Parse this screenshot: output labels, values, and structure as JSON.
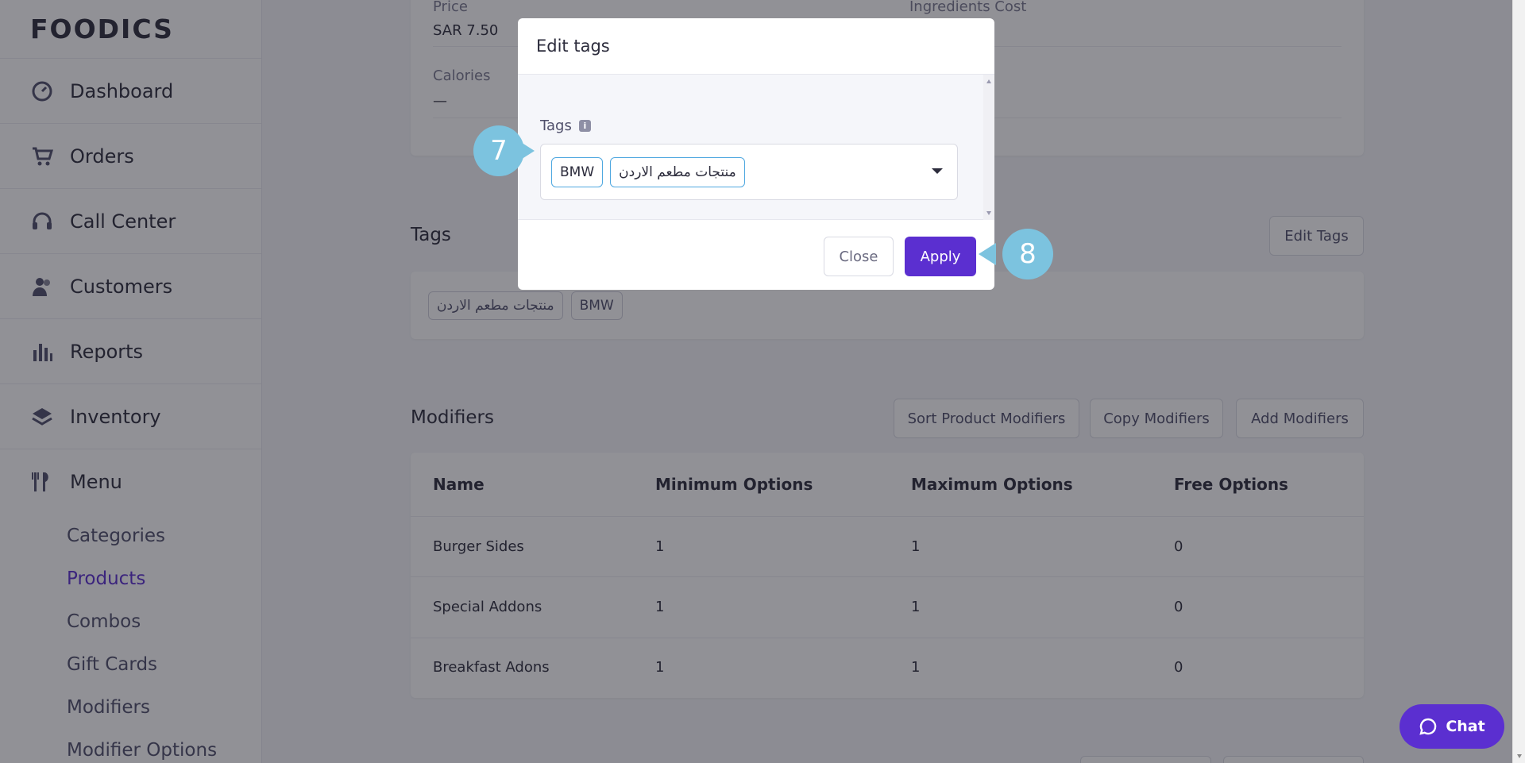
{
  "brand": {
    "logo_text": "FOODICS"
  },
  "sidebar": {
    "items": [
      {
        "label": "Dashboard",
        "icon": "dashboard-icon"
      },
      {
        "label": "Orders",
        "icon": "cart-icon"
      },
      {
        "label": "Call Center",
        "icon": "headset-icon"
      },
      {
        "label": "Customers",
        "icon": "users-icon"
      },
      {
        "label": "Reports",
        "icon": "bar-chart-icon"
      },
      {
        "label": "Inventory",
        "icon": "layers-icon"
      },
      {
        "label": "Menu",
        "icon": "utensils-icon"
      }
    ],
    "menu_subitems": [
      "Categories",
      "Products",
      "Combos",
      "Gift Cards",
      "Modifiers",
      "Modifier Options"
    ],
    "active_subitem": "Products"
  },
  "product_info": {
    "price_label": "Price",
    "price_value": "SAR 7.50",
    "ingredients_cost_label": "Ingredients Cost",
    "calories_label": "Calories",
    "calories_value": "—"
  },
  "tags_section": {
    "title": "Tags",
    "edit_button": "Edit Tags",
    "tags": [
      "منتجات مطعم الاردن",
      "BMW"
    ]
  },
  "modifiers_section": {
    "title": "Modifiers",
    "buttons": {
      "sort": "Sort Product Modifiers",
      "copy": "Copy Modifiers",
      "add": "Add Modifiers"
    },
    "columns": [
      "Name",
      "Minimum Options",
      "Maximum Options",
      "Free Options"
    ],
    "rows": [
      [
        "Burger Sides",
        "1",
        "1",
        "0"
      ],
      [
        "Special Addons",
        "1",
        "1",
        "0"
      ],
      [
        "Breakfast Adons",
        "1",
        "1",
        "0"
      ]
    ]
  },
  "modal": {
    "title": "Edit tags",
    "field_label": "Tags",
    "selected_tags": [
      "BMW",
      "منتجات مطعم الاردن"
    ],
    "close_button": "Close",
    "apply_button": "Apply"
  },
  "callouts": {
    "step_a": "7",
    "step_b": "8"
  },
  "chat": {
    "label": "Chat"
  },
  "colors": {
    "accent": "#5b2fd0",
    "callout": "#7cc3df",
    "chip_border": "#4fa8e0"
  }
}
